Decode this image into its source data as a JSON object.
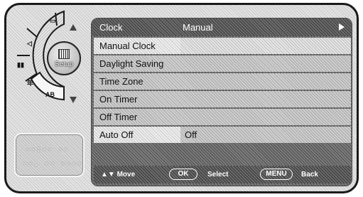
{
  "wheel": {
    "hub_label": "Setup",
    "segments": [
      {
        "icon": "picture-icon",
        "label": ""
      },
      {
        "icon": "speaker-icon",
        "label": ""
      },
      {
        "icon": "channel-icon",
        "label": ""
      },
      {
        "icon": "lock-icon",
        "label": "年"
      },
      {
        "icon": "language-icon",
        "label": "AB"
      }
    ]
  },
  "time_display": {
    "line1": "--:-- --",
    "line2": "--. -- ----"
  },
  "panel": {
    "title_label": "Clock",
    "title_value": "Manual",
    "rows": [
      {
        "label": "Manual Clock",
        "value": ""
      },
      {
        "label": "Daylight Saving",
        "value": ""
      },
      {
        "label": "Time Zone",
        "value": ""
      },
      {
        "label": "On Timer",
        "value": ""
      },
      {
        "label": "Off Timer",
        "value": ""
      },
      {
        "label": "Auto Off",
        "value": "Off"
      }
    ]
  },
  "footer": {
    "move_label": "▲▼ Move",
    "ok_label": "OK",
    "select_label": "Select",
    "menu_label": "MENU",
    "back_label": "Back"
  }
}
